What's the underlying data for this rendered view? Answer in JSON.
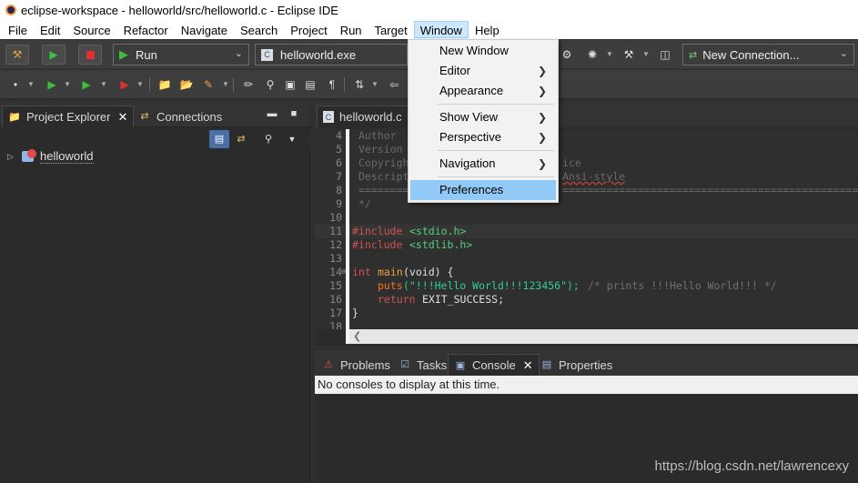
{
  "window": {
    "title": "eclipse-workspace - helloworld/src/helloworld.c - Eclipse IDE"
  },
  "menubar": [
    "File",
    "Edit",
    "Source",
    "Refactor",
    "Navigate",
    "Search",
    "Project",
    "Run",
    "Target",
    "Window",
    "Help"
  ],
  "toolbar": {
    "mode": "Run",
    "launch_target": "helloworld.exe",
    "connection": "New Connection..."
  },
  "window_menu": {
    "items": [
      {
        "label": "New Window",
        "submenu": false
      },
      {
        "label": "Editor",
        "submenu": true
      },
      {
        "label": "Appearance",
        "submenu": true
      },
      {
        "label": "Show View",
        "submenu": true
      },
      {
        "label": "Perspective",
        "submenu": true
      },
      {
        "label": "Navigation",
        "submenu": true
      },
      {
        "label": "Preferences",
        "submenu": false,
        "highlighted": true
      }
    ]
  },
  "left_panel": {
    "tabs": [
      {
        "label": "Project Explorer",
        "active": true
      },
      {
        "label": "Connections",
        "active": false
      }
    ],
    "tree": [
      {
        "label": "helloworld"
      }
    ]
  },
  "editor": {
    "tab": "helloworld.c",
    "lines": [
      {
        "n": "4",
        "text": "Author"
      },
      {
        "n": "5",
        "text": "Version"
      },
      {
        "n": "6",
        "text": "Copyrigh",
        "tail": "ice"
      },
      {
        "n": "7",
        "text": "Descript",
        "tail": "Ansi-style"
      },
      {
        "n": "8",
        "text": "========",
        "tail": "================================================"
      },
      {
        "n": "9",
        "text": "*/"
      },
      {
        "n": "10",
        "text": ""
      },
      {
        "n": "11",
        "pre": "#include",
        "inc": "<stdio.h>"
      },
      {
        "n": "12",
        "pre": "#include",
        "inc": "<stdlib.h>"
      },
      {
        "n": "13",
        "text": ""
      },
      {
        "n": "14",
        "kw": "int",
        "fn": "main",
        "rest": "(void) {"
      },
      {
        "n": "15",
        "call": "puts",
        "str": "(\"!!!Hello World!!!123456\");",
        "cmt": "/* prints !!!Hello World!!! */"
      },
      {
        "n": "16",
        "kw": "return",
        "rest2": "EXIT_SUCCESS;"
      },
      {
        "n": "17",
        "text": "}"
      },
      {
        "n": "18",
        "text": ""
      }
    ]
  },
  "bottom_panel": {
    "tabs": [
      {
        "label": "Problems",
        "active": false
      },
      {
        "label": "Tasks",
        "active": false
      },
      {
        "label": "Console",
        "active": true
      },
      {
        "label": "Properties",
        "active": false
      }
    ],
    "message": "No consoles to display at this time."
  },
  "watermark": "https://blog.csdn.net/lawrencexy",
  "colors": {
    "menu_highlight": "#91c9f7",
    "active_menu": "#cce8ff",
    "preproc": "#d25252",
    "include": "#52d07e",
    "string": "#32cd96"
  }
}
